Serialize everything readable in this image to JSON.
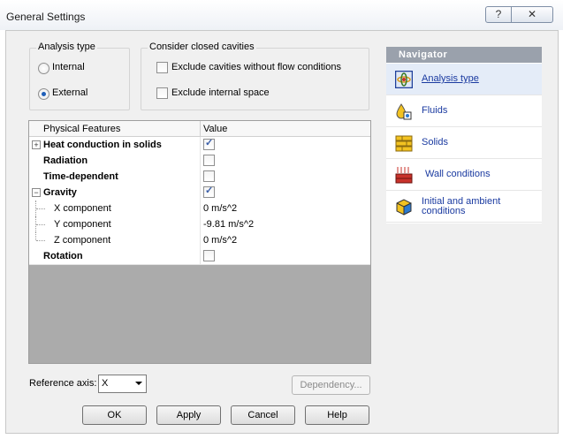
{
  "window": {
    "title": "General Settings",
    "help_glyph": "?",
    "close_glyph": "✕"
  },
  "analysis_type": {
    "title": "Analysis type",
    "options": [
      {
        "label": "Internal",
        "selected": false
      },
      {
        "label": "External",
        "selected": true
      }
    ]
  },
  "cavities": {
    "title": "Consider closed cavities",
    "options": [
      {
        "label": "Exclude cavities without flow conditions",
        "checked": false
      },
      {
        "label": "Exclude internal space",
        "checked": false
      }
    ]
  },
  "table": {
    "columns": [
      "Physical Features",
      "Value"
    ],
    "rows": [
      {
        "name": "Heat conduction in solids",
        "value": "",
        "type": "checkbox",
        "checked": true,
        "expander": "+"
      },
      {
        "name": "Radiation",
        "value": "",
        "type": "checkbox",
        "checked": false
      },
      {
        "name": "Time-dependent",
        "value": "",
        "type": "checkbox",
        "checked": false
      },
      {
        "name": "Gravity",
        "value": "",
        "type": "checkbox",
        "checked": true,
        "expander": "−"
      },
      {
        "name": "X component",
        "value": "0 m/s^2",
        "type": "text"
      },
      {
        "name": "Y component",
        "value": "-9.81 m/s^2",
        "type": "text"
      },
      {
        "name": "Z component",
        "value": "0 m/s^2",
        "type": "text"
      },
      {
        "name": "Rotation",
        "value": "",
        "type": "checkbox",
        "checked": false
      }
    ]
  },
  "reference_axis": {
    "label": "Reference axis:",
    "value": "X"
  },
  "buttons": {
    "dependency": "Dependency...",
    "ok": "OK",
    "apply": "Apply",
    "cancel": "Cancel",
    "help": "Help"
  },
  "navigator": {
    "title": "Navigator",
    "items": [
      {
        "label": "Analysis type",
        "icon": "analysis-type-icon",
        "active": true
      },
      {
        "label": "Fluids",
        "icon": "fluids-icon",
        "active": false
      },
      {
        "label": "Solids",
        "icon": "solids-icon",
        "active": false
      },
      {
        "label": "Wall conditions",
        "icon": "wall-conditions-icon",
        "active": false
      },
      {
        "label_line1": "Initial and ambient",
        "label_line2": "conditions",
        "icon": "initial-conditions-icon",
        "active": false
      }
    ]
  },
  "colors": {
    "accent": "#1f5fb8",
    "navigator_header": "#9aa1ac",
    "link": "#1a3aa0"
  }
}
